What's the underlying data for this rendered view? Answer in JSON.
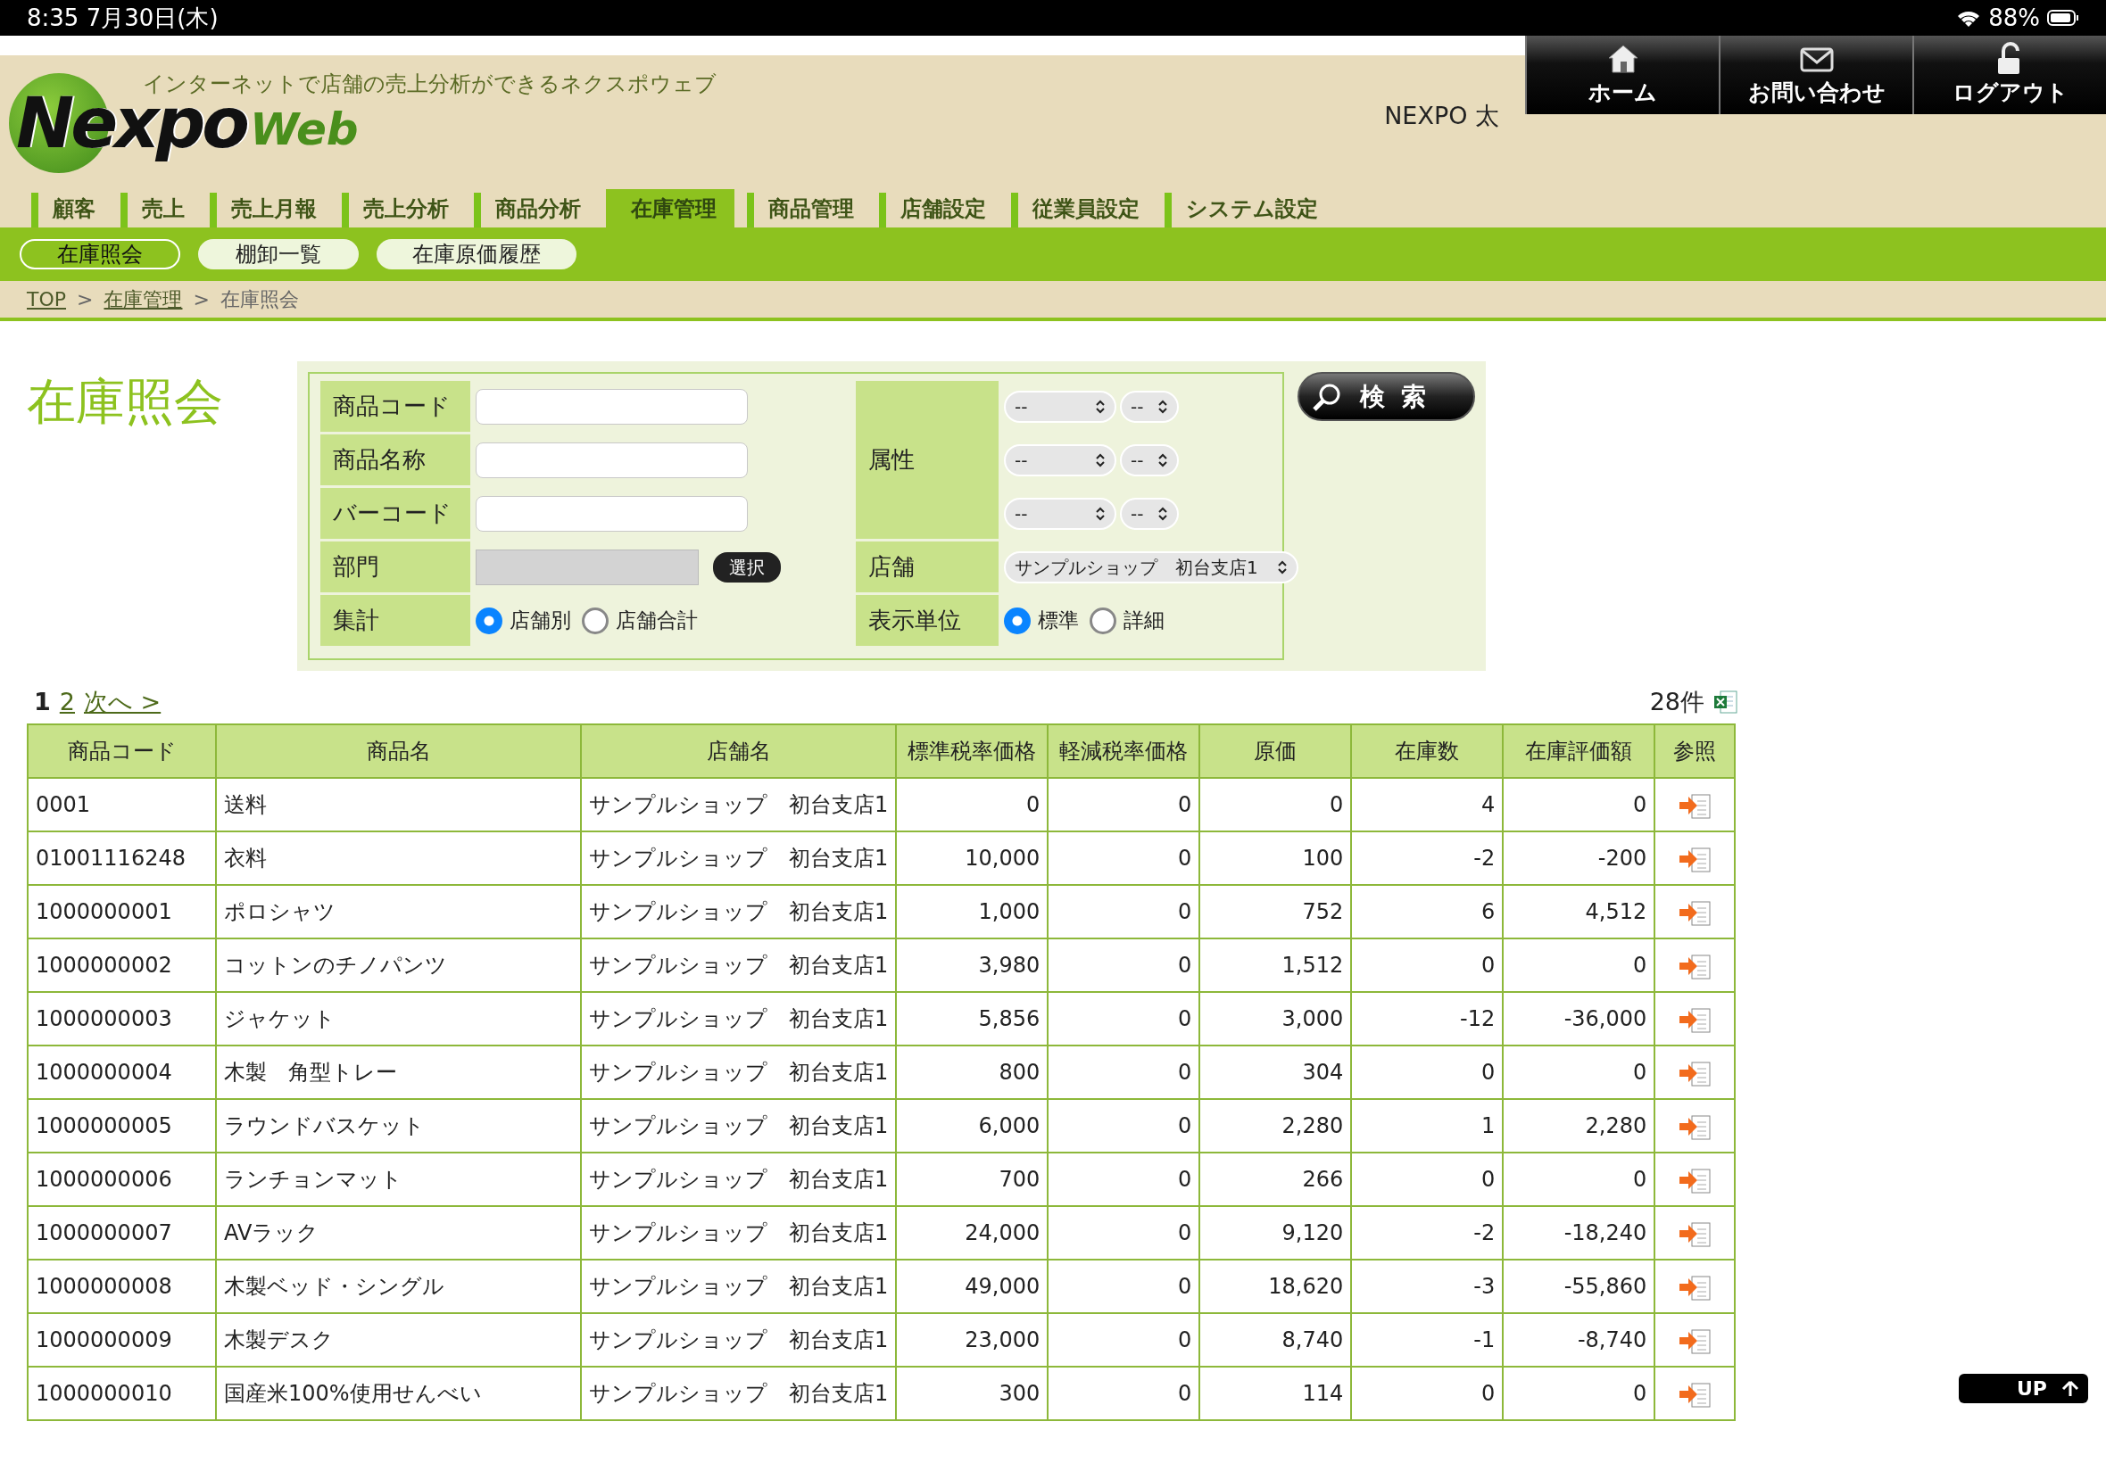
{
  "status_bar": {
    "time": "8:35  7月30日(木)",
    "battery": "88%"
  },
  "header": {
    "tagline": "インターネットで店舗の売上分析ができるネクスポウェブ",
    "logo": {
      "main": "Nexpo",
      "sub": "Web"
    },
    "user": "NEXPO 太",
    "buttons": [
      {
        "label": "ホーム",
        "kind": "home"
      },
      {
        "label": "お問い合わせ",
        "kind": "mail"
      },
      {
        "label": "ログアウト",
        "kind": "lock"
      }
    ]
  },
  "nav_tabs": [
    {
      "label": "顧客",
      "selected": false
    },
    {
      "label": "売上",
      "selected": false
    },
    {
      "label": "売上月報",
      "selected": false
    },
    {
      "label": "売上分析",
      "selected": false
    },
    {
      "label": "商品分析",
      "selected": false
    },
    {
      "label": "在庫管理",
      "selected": true
    },
    {
      "label": "商品管理",
      "selected": false
    },
    {
      "label": "店舗設定",
      "selected": false
    },
    {
      "label": "従業員設定",
      "selected": false
    },
    {
      "label": "システム設定",
      "selected": false
    }
  ],
  "sub_tabs": [
    {
      "label": "在庫照会",
      "selected": true
    },
    {
      "label": "棚卸一覧",
      "selected": false
    },
    {
      "label": "在庫原価履歴",
      "selected": false
    }
  ],
  "breadcrumb": [
    {
      "label": "TOP",
      "kind": "link"
    },
    {
      "label": ">",
      "kind": "sep"
    },
    {
      "label": "在庫管理",
      "kind": "link"
    },
    {
      "label": ">",
      "kind": "sep"
    },
    {
      "label": "在庫照会",
      "kind": "current"
    }
  ],
  "page_title": "在庫照会",
  "search_form": {
    "code_label": "商品コード",
    "name_label": "商品名称",
    "barcode_label": "バーコード",
    "dept_label": "部門",
    "dept_button": "選択",
    "total_label": "集計",
    "total_options": [
      {
        "label": "店舗別",
        "selected": true
      },
      {
        "label": "店舗合計",
        "selected": false
      }
    ],
    "attr_label": "属性",
    "attr_selects": [
      [
        "--",
        "--"
      ],
      [
        "--",
        "--"
      ],
      [
        "--",
        "--"
      ]
    ],
    "store_label": "店舗",
    "store_value": "サンプルショップ　初台支店1",
    "unit_label": "表示単位",
    "unit_options": [
      {
        "label": "標準",
        "selected": true
      },
      {
        "label": "詳細",
        "selected": false
      }
    ],
    "search_button": "検 索"
  },
  "pagination": {
    "pages": [
      {
        "label": "1",
        "selected": true
      },
      {
        "label": "2",
        "selected": false
      }
    ],
    "next": "次へ >",
    "count": "28件"
  },
  "table": {
    "columns": [
      "商品コード",
      "商品名",
      "店舗名",
      "標準税率価格",
      "軽減税率価格",
      "原価",
      "在庫数",
      "在庫評価額",
      "参照"
    ],
    "rows": [
      [
        "0001",
        "送料",
        "サンプルショップ　初台支店1",
        "0",
        "0",
        "0",
        "4",
        "0"
      ],
      [
        "01001116248",
        "衣料",
        "サンプルショップ　初台支店1",
        "10,000",
        "0",
        "100",
        "-2",
        "-200"
      ],
      [
        "1000000001",
        "ポロシャツ",
        "サンプルショップ　初台支店1",
        "1,000",
        "0",
        "752",
        "6",
        "4,512"
      ],
      [
        "1000000002",
        "コットンのチノパンツ",
        "サンプルショップ　初台支店1",
        "3,980",
        "0",
        "1,512",
        "0",
        "0"
      ],
      [
        "1000000003",
        "ジャケット",
        "サンプルショップ　初台支店1",
        "5,856",
        "0",
        "3,000",
        "-12",
        "-36,000"
      ],
      [
        "1000000004",
        "木製　角型トレー",
        "サンプルショップ　初台支店1",
        "800",
        "0",
        "304",
        "0",
        "0"
      ],
      [
        "1000000005",
        "ラウンドバスケット",
        "サンプルショップ　初台支店1",
        "6,000",
        "0",
        "2,280",
        "1",
        "2,280"
      ],
      [
        "1000000006",
        "ランチョンマット",
        "サンプルショップ　初台支店1",
        "700",
        "0",
        "266",
        "0",
        "0"
      ],
      [
        "1000000007",
        "AVラック",
        "サンプルショップ　初台支店1",
        "24,000",
        "0",
        "9,120",
        "-2",
        "-18,240"
      ],
      [
        "1000000008",
        "木製ベッド・シングル",
        "サンプルショップ　初台支店1",
        "49,000",
        "0",
        "18,620",
        "-3",
        "-55,860"
      ],
      [
        "1000000009",
        "木製デスク",
        "サンプルショップ　初台支店1",
        "23,000",
        "0",
        "8,740",
        "-1",
        "-8,740"
      ],
      [
        "1000000010",
        "国産米100%使用せんべい",
        "サンプルショップ　初台支店1",
        "300",
        "0",
        "114",
        "0",
        "0"
      ]
    ]
  },
  "up_button": "UP"
}
